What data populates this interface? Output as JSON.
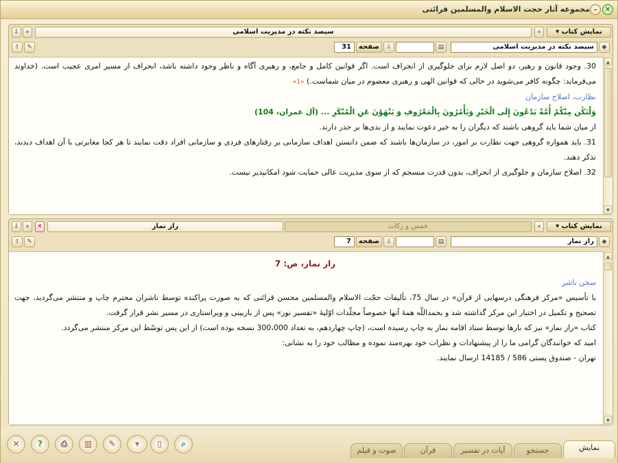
{
  "window": {
    "title": "مجموعه آثار حجت الاسلام والمسلمين قرائتى"
  },
  "top_panel": {
    "show_book_label": "نمايش كتاب",
    "book_title": "سيصد نكته در مديريت اسلامى",
    "book_dropdown": "سيصد نكته در مديريت اسلامى",
    "page_label": "صفحه",
    "page_value": "31"
  },
  "top_content": {
    "p1": "30. وجود قانون و رهبر، دو اصل لازم براى جلوگيرى از انحراف است. اگر قوانين كامل و جامع، و رهبرى آگاه و ناظر وجود داشته باشد، انحراف از مسير امرى عجيب است. (خداوند مى‌فرمايد: چگونه كافر مى‌شويد در حالى كه قوانين الهى و رهبرى معصوم در ميان شماست.)",
    "p1_ref": "«1»",
    "heading": "نظارت، اصلاح سازمان",
    "quran": "وَلْتَكُن مِنْكُمْ أُمَّةٌ يَدْعُونَ إِلَى الْخَيْرِ وَيَأْمُرُونَ بِالْمَعْرُوفِ وَ يَنْهَوْنَ عَنِ الْمُنْكَرِ ... (آل عمران، 104)",
    "p2": "از ميان شما بايد گروهى باشند كه ديگران را به خير دعوت نمايند و از بدى‌ها بر حذر دارند.",
    "p3": "31. بايد همواره گروهى جهت نظارت بر امور، در سازمان‌ها باشند كه ضمن دانستن اهداف سازمانى بر رفتارهاى فردى و سازمانى افراد دقت نمايند تا هر كجا مغايرتى با آن اهداف ديدند، تذكر دهند.",
    "p4": "32. اصلاح سازمان و جلوگيرى از انحراف، بدون قدرت منسجم كه از سوى مديريت عالى حمايت شود امكانپذير نيست."
  },
  "bottom_panel": {
    "show_book_label": "نمايش كتاب",
    "tab_inactive": "خمس و زكات",
    "tab_active": "راز نماز",
    "book_dropdown": "راز نماز",
    "page_label": "صفحه",
    "page_value": "7"
  },
  "bottom_content": {
    "title": "راز نماز، ص:  7",
    "heading": "سخن ناشر",
    "p1": "با تأسيس «مركز فرهنگى درسهايى از قرآن» در سال 75، تأليفات حجّت الاسلام والمسلمين محسن قرائتى كه به صورت پراكنده توسط ناشران محترم چاپ و منتشر مى‌گرديد، جهت تصحيح و تكميل در اختيار اين مركز گذاشته شد و بحمداللّه همهٔ آنها خصوصاً مجلّدات اوّليهٔ «تفسير نور» پس از بازبينى و ويراستارى در مسير نشر قرار گرفت.",
    "p2": "كتاب «راز نماز» نيز كه بارها توسط ستاد اقامه نماز به چاپ رسيده است، (چاپ چهاردهم، به تعداد 300،000 نسخه بوده است) از اين پس توسّط اين مركز منتشر مى‌گردد.",
    "p3": "اميد كه خوانندگان گرامى ما را از پيشنهادات و نظرات خود بهره‌مند نموده و مطالب خود را به نشانى:",
    "p4": "تهران - صندوق پستى 586 / 14185 ارسال نمايند."
  },
  "tabs": [
    "نمايش",
    "جستجو",
    "آيات در تفسير",
    "قرآن",
    "صوت و فيلم"
  ]
}
